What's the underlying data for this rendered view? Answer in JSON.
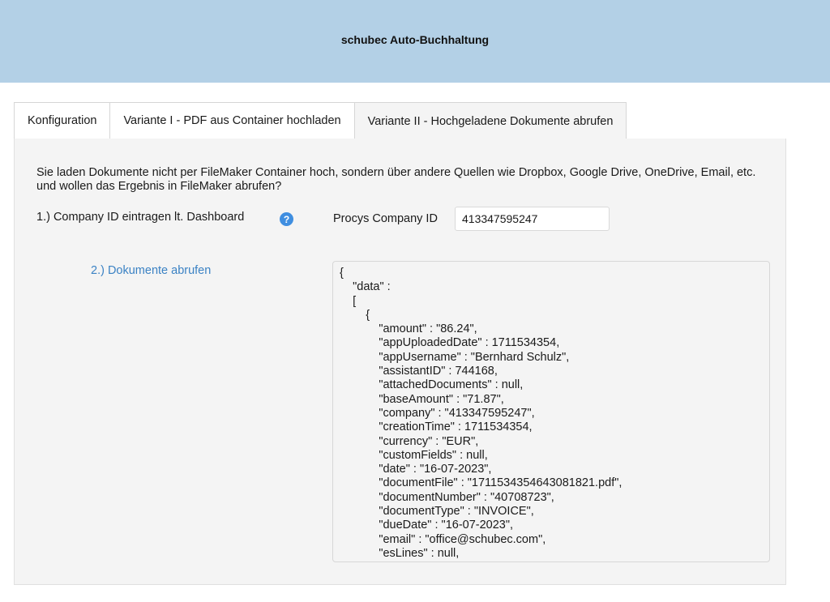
{
  "header": {
    "title": "schubec Auto-Buchhaltung"
  },
  "tabs": [
    {
      "label": "Konfiguration",
      "active": false
    },
    {
      "label": "Variante I - PDF aus Container hochladen",
      "active": false
    },
    {
      "label": "Variante II - Hochgeladene Dokumente abrufen",
      "active": true
    }
  ],
  "panel": {
    "intro": "Sie laden Dokumente nicht per FileMaker Container hoch, sondern über andere Quellen wie Dropbox, Google Drive, OneDrive, Email, etc. und wollen das Ergebnis in FileMaker abrufen?",
    "step1_label": "1.) Company ID eintragen lt. Dashboard",
    "help_glyph": "?",
    "company_label": "Procys Company ID",
    "company_id_value": "413347595247",
    "step2_label": "2.) Dokumente abrufen",
    "json_output": "{\n\t\"data\" : \n\t[\n\t\t{\n\t\t\t\"amount\" : \"86.24\",\n\t\t\t\"appUploadedDate\" : 1711534354,\n\t\t\t\"appUsername\" : \"Bernhard Schulz\",\n\t\t\t\"assistantID\" : 744168,\n\t\t\t\"attachedDocuments\" : null,\n\t\t\t\"baseAmount\" : \"71.87\",\n\t\t\t\"company\" : \"413347595247\",\n\t\t\t\"creationTime\" : 1711534354,\n\t\t\t\"currency\" : \"EUR\",\n\t\t\t\"customFields\" : null,\n\t\t\t\"date\" : \"16-07-2023\",\n\t\t\t\"documentFile\" : \"1711534354643081821.pdf\",\n\t\t\t\"documentNumber\" : \"40708723\",\n\t\t\t\"documentType\" : \"INVOICE\",\n\t\t\t\"dueDate\" : \"16-07-2023\",\n\t\t\t\"email\" : \"office@schubec.com\",\n\t\t\t\"esLines\" : null,"
  },
  "colors": {
    "header_bg": "#b3d0e6",
    "panel_bg": "#f4f4f4",
    "link": "#3b82c4",
    "help_icon": "#3f8ee0"
  }
}
